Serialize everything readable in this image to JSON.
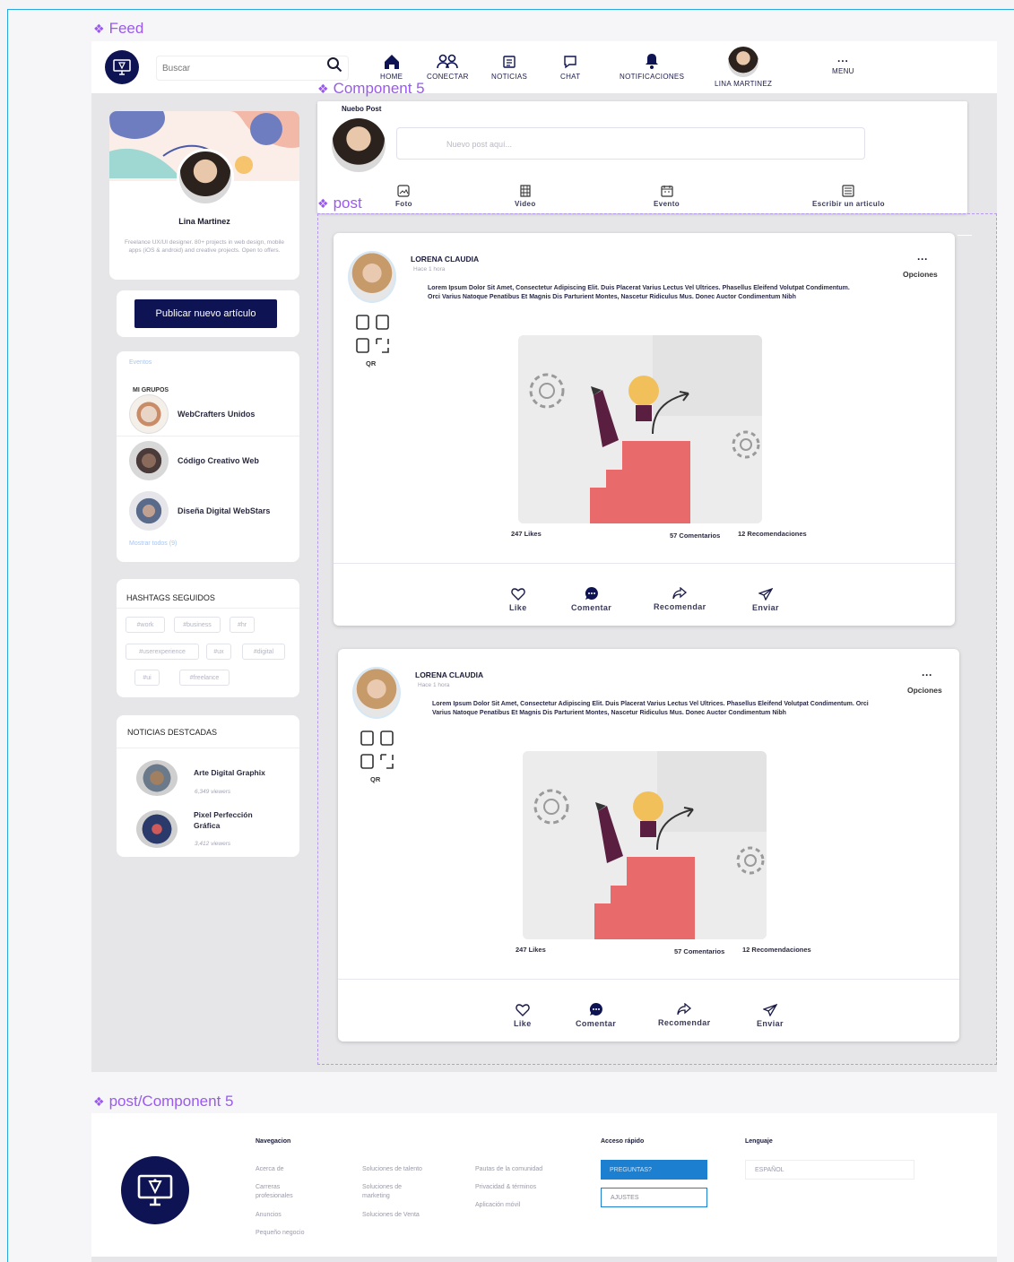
{
  "frame_labels": {
    "feed": "Feed",
    "component5": "Component 5",
    "post": "post",
    "post_component": "post/Component 5"
  },
  "nav": {
    "search_placeholder": "Buscar",
    "items": [
      {
        "label": "HOME"
      },
      {
        "label": "CONECTAR"
      },
      {
        "label": "NOTICIAS"
      },
      {
        "label": "CHAT"
      },
      {
        "label": "NOTIFICACIONES"
      },
      {
        "label": "LINA MARTINEZ"
      },
      {
        "label": "MENU"
      }
    ]
  },
  "profile": {
    "name": "Lina Martinez",
    "bio": "Freelance UX/UI designer. 80+ projects in web design, mobile apps (iOS & android) and creative projects. Open to offers."
  },
  "publish_button": "Publicar nuevo artículo",
  "groups": {
    "link_top": "Eventos",
    "heading": "MI GRUPOS",
    "items": [
      "WebCrafters Unidos",
      "Código Creativo Web",
      "Diseña Digital WebStars"
    ],
    "link_bottom": "Mostrar todos (9)"
  },
  "hashtags": {
    "heading": "HASHTAGS SEGUIDOS",
    "tags": [
      "#work",
      "#business",
      "#hr",
      "#userexperience",
      "#ux",
      "#digital",
      "#ui",
      "#freelance"
    ]
  },
  "news": {
    "heading": "NOTICIAS DESTCADAS",
    "items": [
      {
        "title": "Arte Digital Graphix",
        "meta": "6,349 viewers"
      },
      {
        "title": "Pixel Perfección Gráfica",
        "meta": "3,412 viewers"
      }
    ]
  },
  "new_post": {
    "title": "Nuebo Post",
    "placeholder": "Nuevo post aquí...",
    "actions": [
      "Foto",
      "Video",
      "Evento",
      "Escribir un articulo"
    ]
  },
  "posts": [
    {
      "author": "LORENA CLAUDIA",
      "sub": "Hace 1 hora",
      "options": "Opciones",
      "qr": "QR",
      "body": "Lorem Ipsum Dolor Sit Amet, Consectetur Adipiscing Elit. Duis Placerat Varius Lectus Vel Ultrices. Phasellus Eleifend Volutpat Condimentum. Orci Varius Natoque Penatibus Et Magnis Dis Parturient Montes, Nascetur Ridiculus Mus. Donec Auctor Condimentum Nibh",
      "likes": "247 Likes",
      "comments": "57 Comentarios",
      "recs": "12 Recomendaciones",
      "actions": [
        "Like",
        "Comentar",
        "Recomendar",
        "Enviar"
      ]
    },
    {
      "author": "LORENA CLAUDIA",
      "sub": "Hace 1 hora",
      "options": "Opciones",
      "qr": "QR",
      "body": "Lorem Ipsum Dolor Sit Amet, Consectetur Adipiscing Elit. Duis Placerat Varius Lectus Vel Ultrices. Phasellus Eleifend Volutpat Condimentum. Orci Varius Natoque Penatibus Et Magnis Dis Parturient Montes, Nascetur Ridiculus Mus. Donec Auctor Condimentum Nibh",
      "likes": "247 Likes",
      "comments": "57 Comentarios",
      "recs": "12 Recomendaciones",
      "actions": [
        "Like",
        "Comentar",
        "Recomendar",
        "Enviar"
      ]
    }
  ],
  "footer": {
    "nav_heading": "Navegacion",
    "col1": [
      "Acerca de",
      "Carreras profesionales",
      "Anuncios",
      "Pequeño negocio"
    ],
    "col2": [
      "Soluciones de talento",
      "Soluciones de marketing",
      "Soluciones de Venta"
    ],
    "col3": [
      "Pautas de la comunidad",
      "Privacidad & términos",
      "Aplicación móvil"
    ],
    "quick_heading": "Acceso rápido",
    "ask_button": "PREGUNTAS?",
    "settings_button": "AJUSTES",
    "lang_heading": "Lenguaje",
    "lang_value": "ESPAÑOL"
  },
  "colors": {
    "accent": "#0e1353",
    "frame_label": "#9b59f0",
    "illus_red": "#e86a6a",
    "ask_btn": "#1d7fd0"
  }
}
